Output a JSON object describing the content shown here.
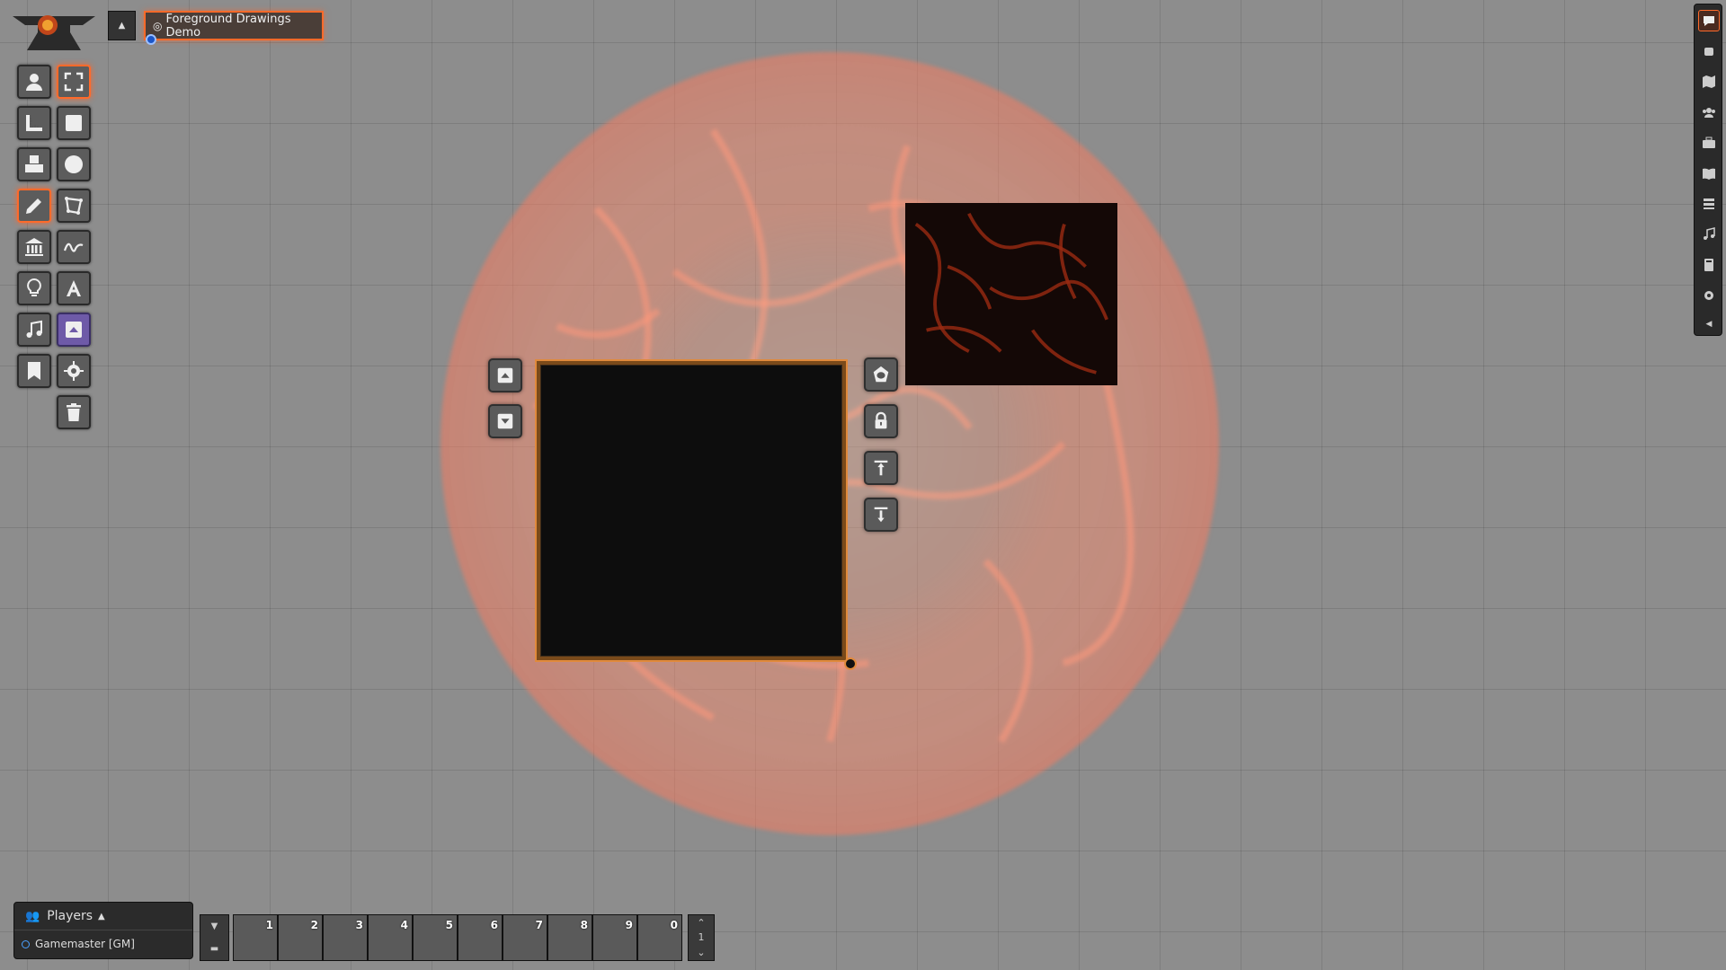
{
  "scene": {
    "tab_label": "Foreground Drawings Demo"
  },
  "players": {
    "title": "Players",
    "entries": [
      {
        "name": "Gamemaster [GM]"
      }
    ]
  },
  "hotbar": {
    "slots": [
      "1",
      "2",
      "3",
      "4",
      "5",
      "6",
      "7",
      "8",
      "9",
      "0"
    ],
    "page": "1"
  },
  "tools_left": [
    {
      "name": "token-controls",
      "icon": "person-icon"
    },
    {
      "name": "select",
      "icon": "fullscreen-icon",
      "active": true
    },
    {
      "name": "measure",
      "icon": "ruler-icon"
    },
    {
      "name": "rect",
      "icon": "square-icon"
    },
    {
      "name": "tiles",
      "icon": "cubes-icon"
    },
    {
      "name": "ellipse",
      "icon": "circle-icon"
    },
    {
      "name": "drawings",
      "icon": "pencil-icon",
      "active": true
    },
    {
      "name": "polygon",
      "icon": "polygon-icon"
    },
    {
      "name": "walls",
      "icon": "building-icon"
    },
    {
      "name": "freehand",
      "icon": "signature-icon"
    },
    {
      "name": "lighting",
      "icon": "lightbulb-icon"
    },
    {
      "name": "text",
      "icon": "font-icon"
    },
    {
      "name": "sounds",
      "icon": "music-icon"
    },
    {
      "name": "foreground",
      "icon": "up-arrow-square-icon",
      "purple": true
    },
    {
      "name": "notes",
      "icon": "bookmark-icon"
    },
    {
      "name": "config",
      "icon": "gear-icon"
    },
    {
      "name": "clear",
      "icon": "trash-icon"
    }
  ],
  "sidebar_tabs": [
    "chat-icon",
    "fist-icon",
    "map-icon",
    "users-icon",
    "suitcase-icon",
    "book-icon",
    "list-icon",
    "music-icon",
    "journal-icon",
    "cogs-icon",
    "collapse-icon"
  ],
  "colors": {
    "accent": "#ff6a2a",
    "selection": "#e08a3c",
    "grid_bg": "#8d8d8d"
  }
}
